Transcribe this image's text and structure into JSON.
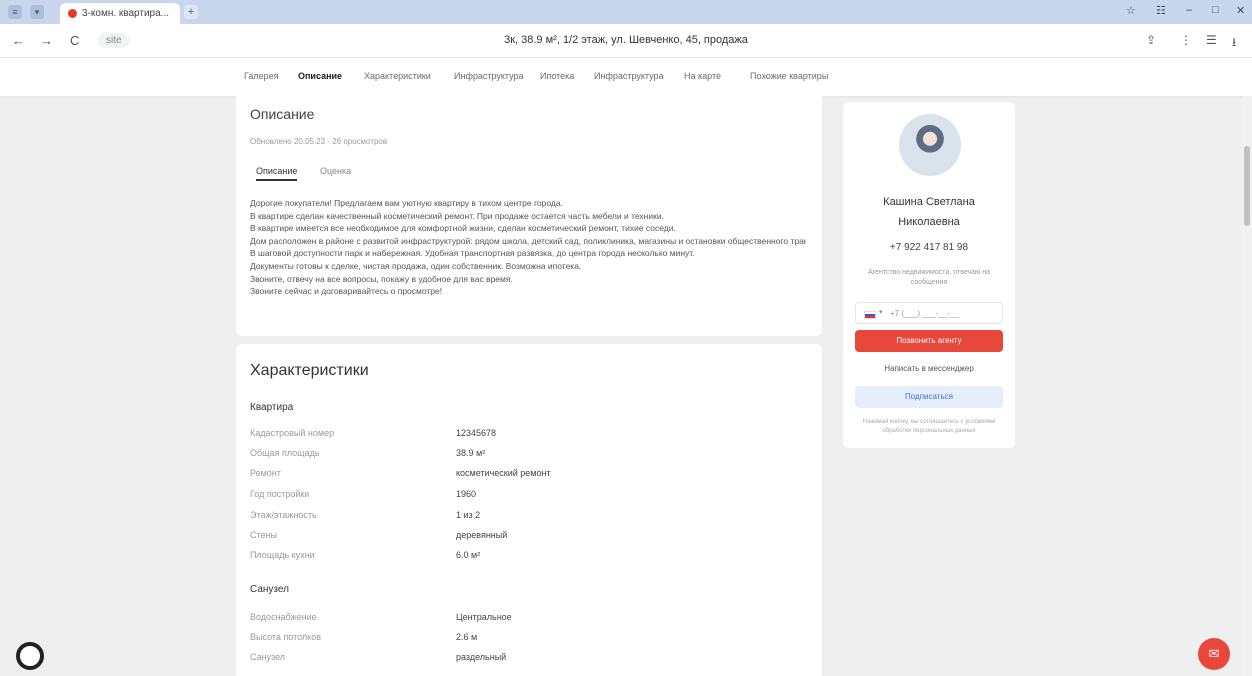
{
  "browser": {
    "tab_title": "3-комн. квартира...",
    "new_tab": "+",
    "site_chip": "site",
    "url": "3к, 38.9 м², 1/2 этаж, ул. Шевченко, 45, продажа",
    "nav_back": "←",
    "nav_forward": "→",
    "nav_reload": "C"
  },
  "sitenav": {
    "items": [
      "Галерея",
      "Описание",
      "Характеристики",
      "Инфраструктура",
      "Ипотека",
      "Инфраструктура",
      "На карте",
      "Похожие квартиры"
    ],
    "active_index": 1
  },
  "description": {
    "title": "Описание",
    "meta": "Обновлено 20.05.23 · 26 просмотров",
    "tabs": [
      "Описание",
      "Оценка"
    ],
    "active_tab": 0,
    "lines": [
      "Дорогие покупатели! Предлагаем вам уютную квартиру в тихом центре города.",
      "В квартире сделан качественный косметический ремонт. При продаже остается часть мебели и техники.",
      "В квартире имеется все необходимое для комфортной жизни, сделан косметический ремонт, тихие соседи.",
      "Дом расположен в районе с развитой инфраструктурой: рядом школа, детский сад, поликлиника, магазины и остановки общественного транспорта.",
      "В шаговой доступности парк и набережная. Удобная транспортная развязка, до центра города несколько минут.",
      "Документы готовы к сделке, чистая продажа, один собственник. Возможна ипотека.",
      "Звоните, отвечу на все вопросы, покажу в удобное для вас время.",
      "Звоните сейчас и договаривайтесь о просмотре!"
    ]
  },
  "characteristics": {
    "title": "Характеристики",
    "sections": [
      {
        "title": "Квартира",
        "rows": [
          {
            "label": "Кадастровый номер",
            "value": "12345678"
          },
          {
            "label": "Общая площадь",
            "value": "38.9 м²"
          },
          {
            "label": "Ремонт",
            "value": "косметический ремонт"
          },
          {
            "label": "Год постройки",
            "value": "1960"
          },
          {
            "label": "Этаж/этажность",
            "value": "1 из 2"
          },
          {
            "label": "Стены",
            "value": "деревянный"
          },
          {
            "label": "Площадь кухни",
            "value": "6.0 м²"
          }
        ]
      },
      {
        "title": "Санузел",
        "rows": [
          {
            "label": "Водоснабжение",
            "value": "Центральное"
          },
          {
            "label": "Высота потолков",
            "value": "2.6 м"
          },
          {
            "label": "Санузел",
            "value": "раздельный"
          }
        ]
      }
    ]
  },
  "agent": {
    "name_line1": "Кашина Светлана",
    "name_line2": "Николаевна",
    "phone": "+7 922 417 81 98",
    "note": "Агентство недвижимости, отвечаю на сообщения",
    "phone_input_placeholder": "+7 (___) ___-__-__",
    "call_button": "Позвонить агенту",
    "write_button": "Написать в мессенджер",
    "subscribe_button": "Подписаться",
    "legal": "Нажимая кнопку, вы соглашаетесь с условиями обработки персональных данных"
  },
  "colors": {
    "accent_red": "#e8473b",
    "blue_soft": "#e6eefb"
  }
}
